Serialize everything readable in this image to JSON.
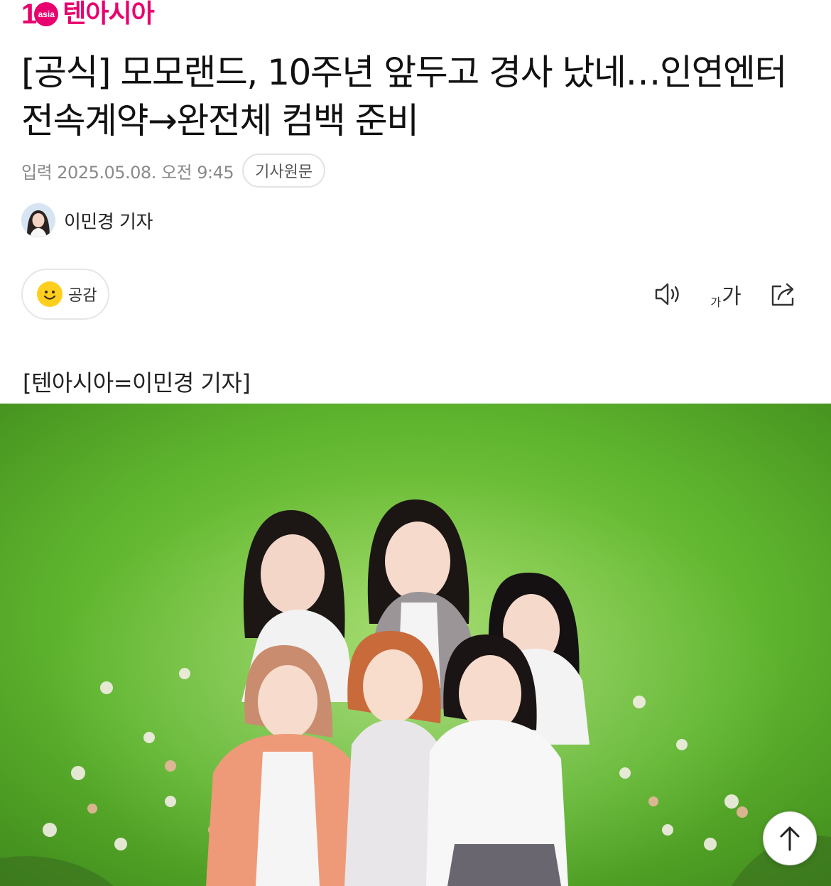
{
  "brand": {
    "logo_mark": "asia",
    "logo_text": "텐아시아",
    "color": "#e8006f"
  },
  "article": {
    "title": "[공식] 모모랜드, 10주년 앞두고 경사 났네…인연엔터 전속계약→완전체 컴백 준비",
    "published": "입력 2025.05.08. 오전 9:45",
    "original_button": "기사원문",
    "author": "이민경 기자",
    "credit": "[텐아시아=이민경 기자]"
  },
  "toolbar": {
    "empathy_label": "공감",
    "font_small": "가",
    "font_big": "가",
    "icons": [
      "smile-icon",
      "speaker-icon",
      "font-size-icon",
      "share-icon"
    ]
  },
  "photo": {
    "description_icon": "group-photo"
  },
  "scroll_top": {
    "icon": "arrow-up-icon"
  }
}
